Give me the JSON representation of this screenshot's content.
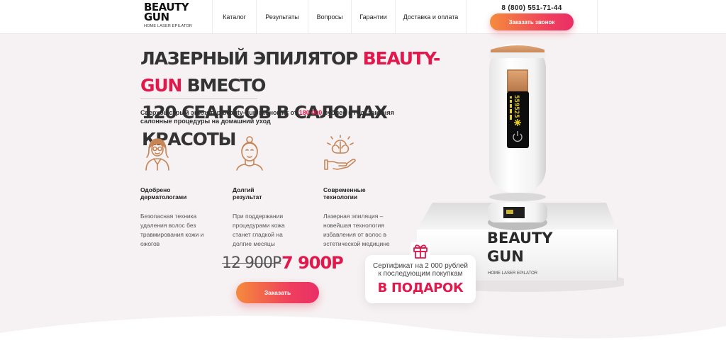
{
  "header": {
    "logo_title": "BEAUTY GUN",
    "logo_subtitle": "HOME LASER EPILATOR",
    "nav": [
      {
        "label": "Каталог"
      },
      {
        "label": "Результаты"
      },
      {
        "label": "Вопросы"
      },
      {
        "label": "Гарантии"
      },
      {
        "label": "Доставка и оплата"
      }
    ],
    "phone": "8 (800) 551-71-44",
    "call_button": "Заказать звонок"
  },
  "hero": {
    "headline_part1": "ЛАЗЕРНЫЙ ЭПИЛЯТОР ",
    "headline_accent": "BEAUTY-GUN",
    "headline_part2": " ВМЕСТО",
    "headline_line2": "120 СЕАНСОВ В САЛОНАХ КРАСОТЫ",
    "subtitle_part1": "Сверхбыстрый эпилятор beauty-gun экономит от ",
    "subtitle_accent": "180 000",
    "subtitle_part2": " рублей в год, заменяя салонные процедуры на домашний уход"
  },
  "features": [
    {
      "icon": "doctor-icon",
      "title": "Одобрено\nдерматологами",
      "text": "Безопасная техника\nудаления волос без\nтравмирования кожи и\nожогов"
    },
    {
      "icon": "woman-face-icon",
      "title": "Долгий\nрезультат",
      "text": "При поддержании\nпроцедурами кожа\nстанет гладкой на\nдолгие месяцы"
    },
    {
      "icon": "brain-hand-icon",
      "title": "Современные\nтехнологии",
      "text": "Лазерная эпиляция –\nновейшая технология\nизбавления от волос в\nэстетической медицине"
    }
  ],
  "price": {
    "old": "12 900Р",
    "new": "7 900Р",
    "order_button": "Заказать"
  },
  "product": {
    "box_brand": "BEAUTY GUN",
    "box_subtitle": "HOME LASER EPILATOR",
    "display_value": "559525"
  },
  "gift": {
    "icon": "gift-icon",
    "text": "Сертификат на 2 000 рублей\nк последующим покупкам",
    "accent": "В ПОДАРОК"
  },
  "colors": {
    "accent": "#e2184c",
    "button_gradient_start": "#f58b3c",
    "button_gradient_end": "#e92e67",
    "icon_copper": "#c78455"
  }
}
